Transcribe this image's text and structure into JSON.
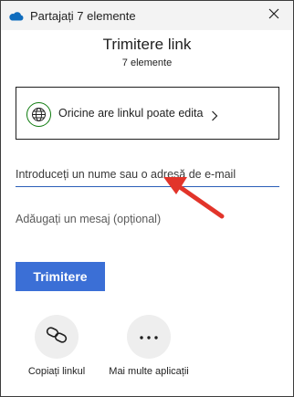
{
  "window": {
    "title": "Partajați 7 elemente"
  },
  "header": {
    "title": "Trimitere link",
    "subtitle": "7 elemente"
  },
  "permission": {
    "label": "Oricine are linkul poate edita"
  },
  "recipient": {
    "placeholder": "Introduceți un nume sau o adresă de e-mail"
  },
  "message": {
    "placeholder": "Adăugați un mesaj (opțional)"
  },
  "actions": {
    "send_label": "Trimitere"
  },
  "share_options": {
    "copy_label": "Copiați linkul",
    "more_label": "Mai multe aplicații"
  },
  "colors": {
    "accent": "#3b6fd6",
    "globe": "#107c10",
    "arrow": "#e2342a",
    "onedrive": "#0f6cbd"
  },
  "icons": [
    "onedrive-cloud-icon",
    "close-icon",
    "globe-icon",
    "chevron-right-icon",
    "link-icon",
    "more-icon"
  ]
}
